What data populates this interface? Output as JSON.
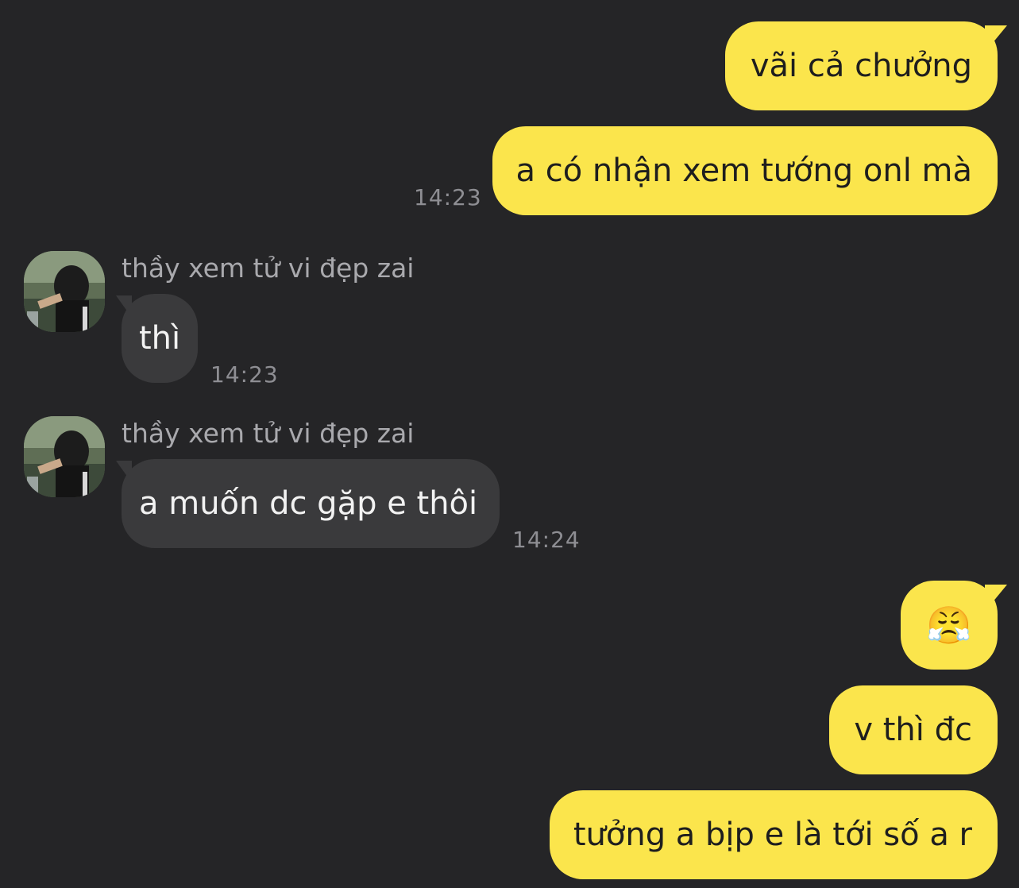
{
  "chat": {
    "contact_name": "thầy xem tử vi đẹp zai",
    "messages": [
      {
        "direction": "outgoing",
        "text": "vãi cả chưởng"
      },
      {
        "direction": "outgoing",
        "text": "a có nhận xem tướng onl mà",
        "time": "14:23"
      },
      {
        "direction": "incoming",
        "sender": "thầy xem tử vi đẹp zai",
        "text": "thì",
        "time": "14:23"
      },
      {
        "direction": "incoming",
        "sender": "thầy xem tử vi đẹp zai",
        "text": "a muốn dc gặp e thôi",
        "time": "14:24"
      },
      {
        "direction": "outgoing",
        "text": "😤"
      },
      {
        "direction": "outgoing",
        "text": "v thì đc"
      },
      {
        "direction": "outgoing",
        "text": "tưởng a bịp e là tới số a r"
      }
    ]
  },
  "colors": {
    "background": "#252527",
    "outgoing_bubble": "#fbe54c",
    "incoming_bubble": "#3a3a3c",
    "timestamp": "#8e8e93"
  },
  "icons": {
    "avatar": "contact-avatar-photo",
    "emoji": "face-with-steam-from-nose"
  }
}
